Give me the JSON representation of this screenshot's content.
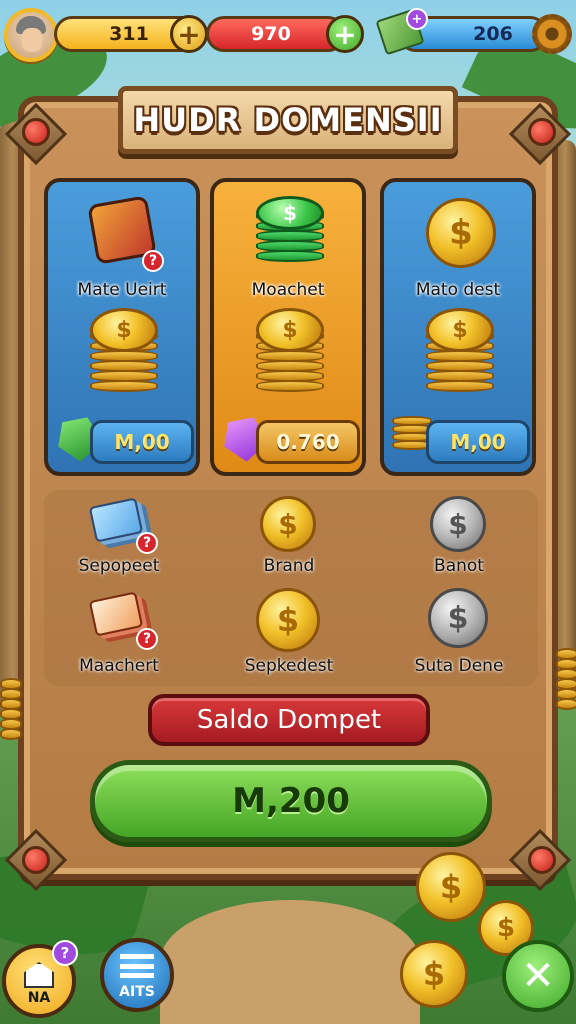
{
  "hud": {
    "gold_amount": "311",
    "red_amount": "970",
    "cash_amount": "206"
  },
  "title": "HUDR DOMENSII",
  "offers": [
    {
      "label": "Mate Ueirt",
      "price": "M,00",
      "color": "#2f73b4"
    },
    {
      "label": "Moachet",
      "price": "0.760",
      "color": "#e08a16"
    },
    {
      "label": "Mato dest",
      "price": "M,00",
      "color": "#2f73b4"
    }
  ],
  "items": [
    {
      "label": "Sepopeet"
    },
    {
      "label": "Brand"
    },
    {
      "label": "Banot"
    },
    {
      "label": "Maachert"
    },
    {
      "label": "Sepkedest"
    },
    {
      "label": "Suta Dene"
    }
  ],
  "saldo_label": "Saldo Dompet",
  "buy_label": "M,200",
  "bottom": {
    "na_label": "NA",
    "aits_label": "AITS"
  },
  "icons": {
    "coin": "dollar-coin-icon",
    "gem": "gem-icon",
    "close": "close-icon",
    "settings": "gear-icon"
  }
}
